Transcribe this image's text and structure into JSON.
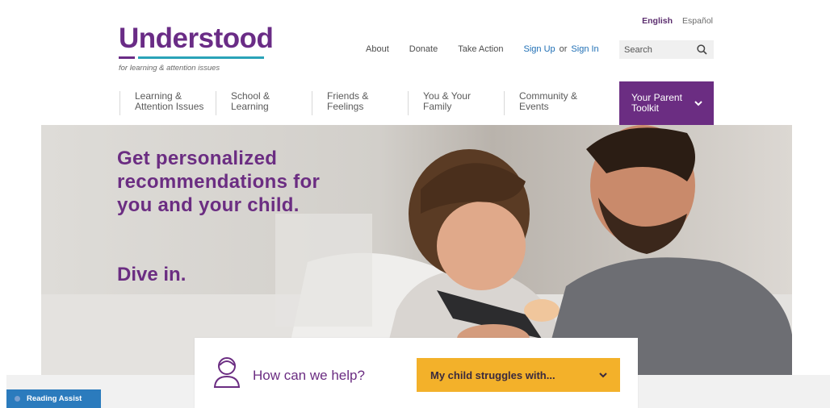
{
  "language": {
    "active": "English",
    "other": "Español"
  },
  "logo": {
    "name": "Understood",
    "tagline": "for learning & attention issues"
  },
  "toplinks": {
    "about": "About",
    "donate": "Donate",
    "take_action": "Take Action",
    "sign_up": "Sign Up",
    "or": "or",
    "sign_in": "Sign In"
  },
  "search": {
    "placeholder": "Search",
    "icon": "search-icon"
  },
  "nav": [
    {
      "line1": "Learning &",
      "line2": "Attention Issues"
    },
    {
      "line1": "School &",
      "line2": "Learning"
    },
    {
      "line1": "Friends &",
      "line2": "Feelings"
    },
    {
      "line1": "You & Your",
      "line2": "Family"
    },
    {
      "line1": "Community &",
      "line2": "Events"
    }
  ],
  "nav_active": {
    "line1": "Your Parent",
    "line2": "Toolkit",
    "icon": "chevron-down-icon"
  },
  "hero": {
    "headline": "Get personalized recommendations for you and your child.",
    "cta": "Dive in."
  },
  "help": {
    "prompt": "How can we help?",
    "dropdown": "My child struggles with...",
    "icon": "person-icon"
  },
  "reading_assist": "Reading Assist",
  "colors": {
    "brand_purple": "#6b2d82",
    "accent_teal": "#2aa3b8",
    "dropdown_yellow": "#f3b12a",
    "link_blue": "#1f6fb5"
  }
}
